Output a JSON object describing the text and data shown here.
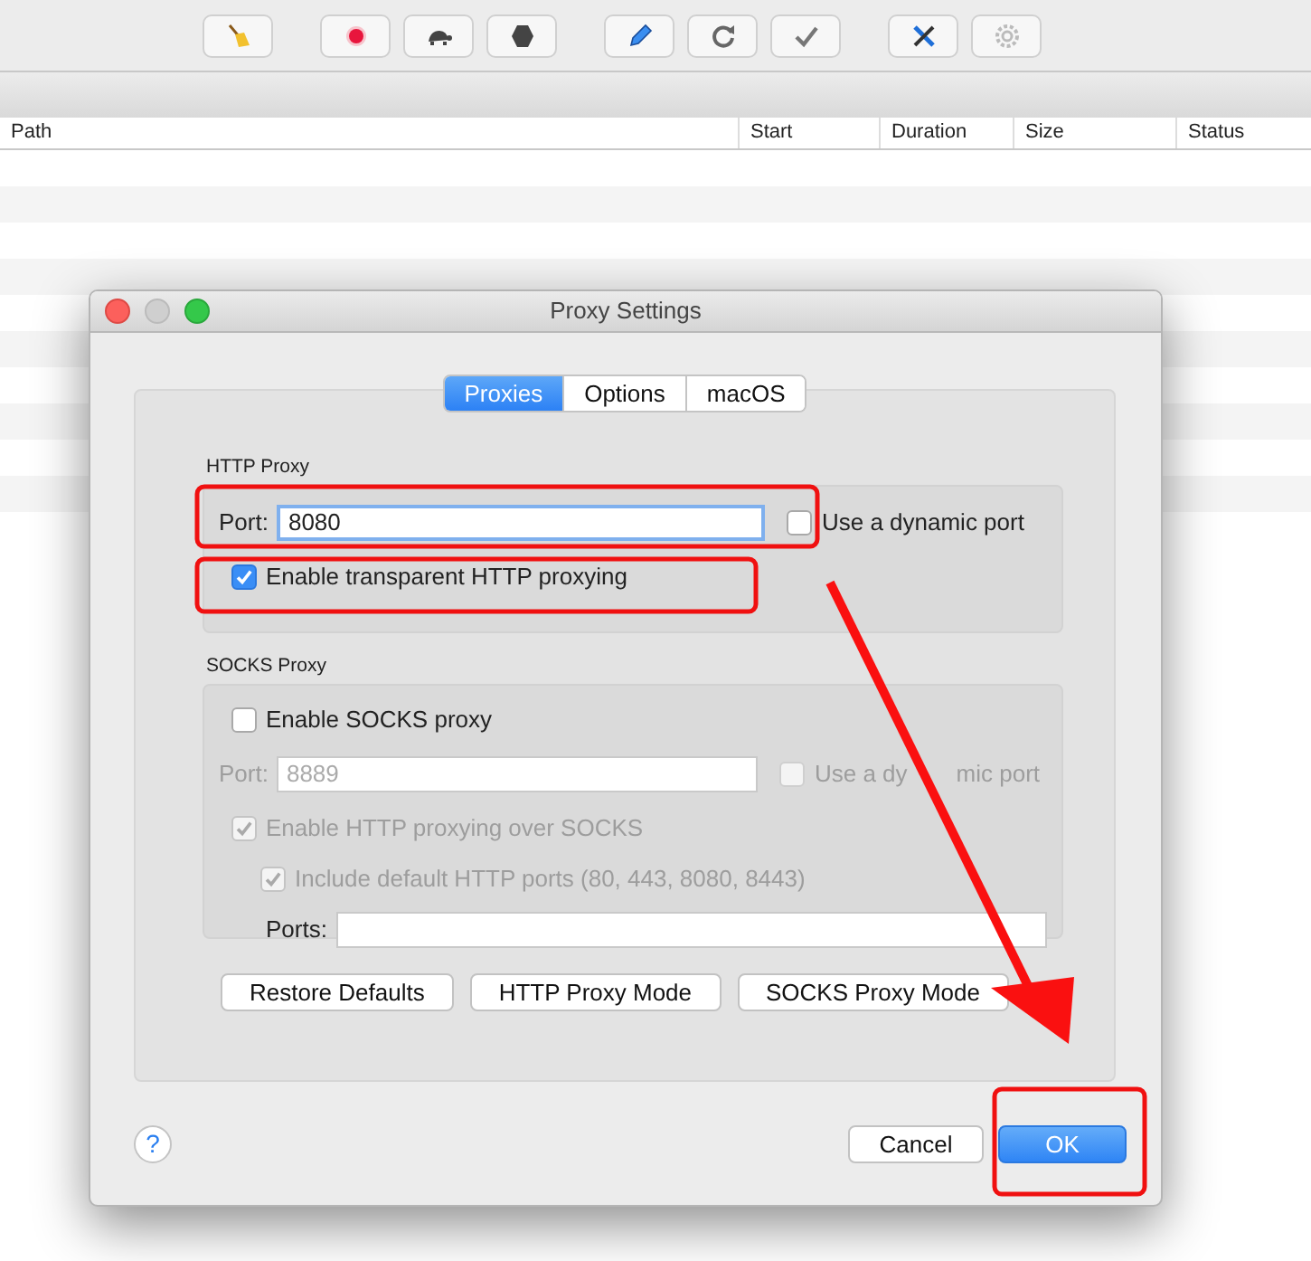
{
  "table": {
    "columns": [
      "Path",
      "Start",
      "Duration",
      "Size",
      "Status"
    ]
  },
  "dialog": {
    "title": "Proxy Settings",
    "tabs": [
      {
        "label": "Proxies",
        "selected": true
      },
      {
        "label": "Options",
        "selected": false
      },
      {
        "label": "macOS",
        "selected": false
      }
    ],
    "http_proxy": {
      "legend": "HTTP Proxy",
      "port_label": "Port:",
      "port_value": "8080",
      "port_selected": true,
      "dynamic_port": {
        "label": "Use a dynamic port",
        "checked": false,
        "disabled": false
      },
      "transparent": {
        "label": "Enable transparent HTTP proxying",
        "checked": true,
        "disabled": false
      }
    },
    "socks_proxy": {
      "legend": "SOCKS Proxy",
      "enable": {
        "label": "Enable SOCKS proxy",
        "checked": false,
        "disabled": false
      },
      "port_label": "Port:",
      "port_value": "8889",
      "port_disabled": true,
      "dynamic_port": {
        "label_parts": [
          "Use a dy",
          "mic port"
        ],
        "checked": false,
        "disabled": true
      },
      "http_over_socks": {
        "label": "Enable HTTP proxying over SOCKS",
        "checked": true,
        "disabled": true
      },
      "include_default_ports": {
        "label": "Include default HTTP ports (80, 443, 8080, 8443)",
        "checked": true,
        "disabled": true
      },
      "ports_label": "Ports:"
    },
    "mode_buttons": [
      "Restore Defaults",
      "HTTP Proxy Mode",
      "SOCKS Proxy Mode"
    ],
    "help": "?",
    "footer_buttons": [
      {
        "label": "Cancel",
        "default": false
      },
      {
        "label": "OK",
        "default": true
      }
    ]
  }
}
